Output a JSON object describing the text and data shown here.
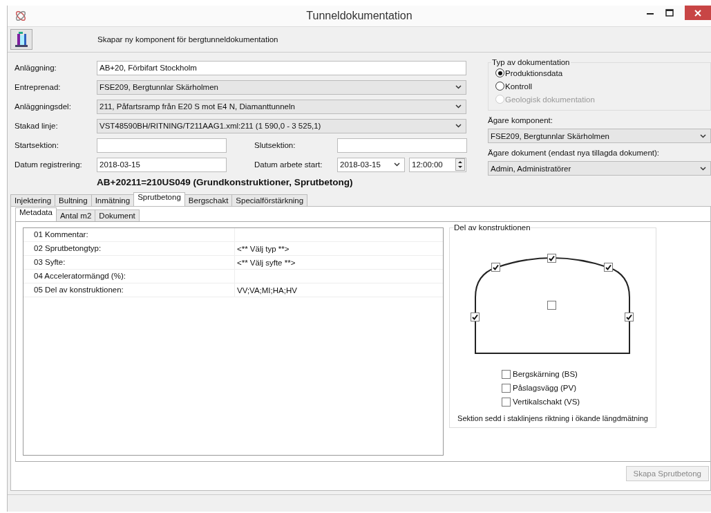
{
  "window": {
    "title": "Tunneldokumentation"
  },
  "toolbar": {
    "caption": "Skapar ny komponent för bergtunneldokumentation"
  },
  "fields": [
    {
      "label": "Anläggning:",
      "value": "AB+20, Förbifart Stockholm",
      "kind": "text"
    },
    {
      "label": "Entreprenad:",
      "value": "FSE209, Bergtunnlar Skärholmen",
      "kind": "combo"
    },
    {
      "label": "Anläggningsdel:",
      "value": "211, Påfartsramp från E20 S mot E4 N, Diamanttunneln",
      "kind": "combo"
    },
    {
      "label": "Stakad linje:",
      "value": "VST48590BH/RITNING/T211AAG1.xml:211 (1 590,0 - 3 525,1)",
      "kind": "combo"
    }
  ],
  "start_section": {
    "label": "Startsektion:"
  },
  "end_section": {
    "label": "Slutsektion:"
  },
  "registration_date": {
    "label": "Datum registrering:",
    "value": "2018-03-15"
  },
  "work_start": {
    "label": "Datum arbete start:",
    "date": "2018-03-15",
    "time": "12:00:00"
  },
  "component_heading": "AB+20211=210US049  (Grundkonstruktioner, Sprutbetong)",
  "documentation_type": {
    "title": "Typ av dokumentation",
    "options": [
      {
        "label": "Produktionsdata",
        "selected": true,
        "disabled": false
      },
      {
        "label": "Kontroll",
        "selected": false,
        "disabled": false
      },
      {
        "label": "Geologisk dokumentation",
        "selected": false,
        "disabled": true
      }
    ]
  },
  "component_owner": {
    "label": "Ägare komponent:",
    "value": "FSE209, Bergtunnlar Skärholmen"
  },
  "document_owner": {
    "label": "Ägare dokument (endast nya tillagda dokument):",
    "value": "Admin, Administratörer"
  },
  "tabs": [
    {
      "label": "Injektering",
      "selected": false
    },
    {
      "label": "Bultning",
      "selected": false
    },
    {
      "label": "Inmätning",
      "selected": false
    },
    {
      "label": "Sprutbetong",
      "selected": true
    },
    {
      "label": "Bergschakt",
      "selected": false
    },
    {
      "label": "Specialförstärkning",
      "selected": false
    }
  ],
  "sub_tabs": [
    {
      "label": "Metadata",
      "selected": true
    },
    {
      "label": "Antal m2",
      "selected": false
    },
    {
      "label": "Dokument",
      "selected": false
    }
  ],
  "properties": [
    {
      "name": "01 Kommentar:"
    },
    {
      "name": "02 Sprutbetongtyp:",
      "value": "<** Välj typ **>"
    },
    {
      "name": "03 Syfte:",
      "value": "<** Välj syfte **>"
    },
    {
      "name": "04 Acceleratormängd (%):"
    },
    {
      "name": "05 Del av konstruktionen:",
      "value": "VV;VA;MI;HA;HV"
    }
  ],
  "construction_part": {
    "title": "Del av konstruktionen",
    "section_checks": [
      {
        "checked": true
      },
      {
        "checked": true
      },
      {
        "checked": true
      },
      {
        "checked": true
      },
      {
        "checked": true
      },
      {
        "checked": false
      }
    ],
    "options": [
      {
        "label": "Bergskärning (BS)",
        "checked": false
      },
      {
        "label": "Påslagsvägg (PV)",
        "checked": false
      },
      {
        "label": "Vertikalschakt (VS)",
        "checked": false
      }
    ],
    "note": "Sektion sedd i staklinjens riktning i ökande längdmätning"
  },
  "create_button": {
    "label": "Skapa Sprutbetong",
    "disabled": true
  }
}
